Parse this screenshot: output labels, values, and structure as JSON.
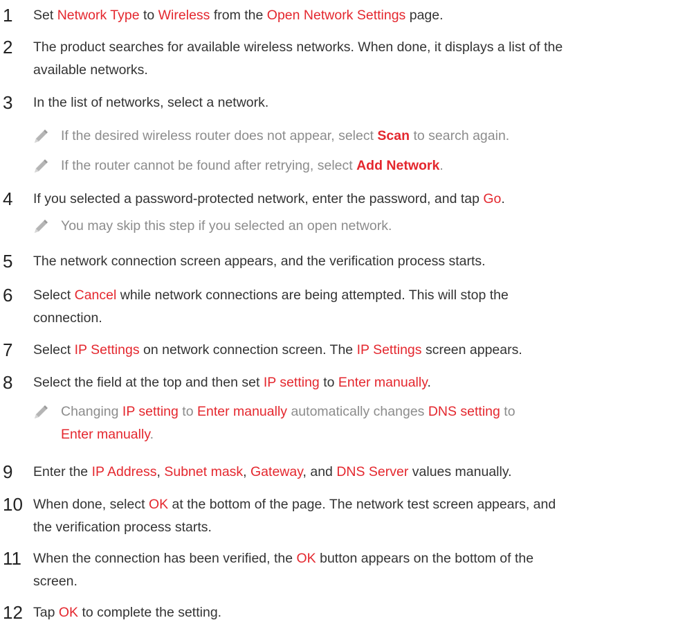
{
  "steps": [
    {
      "num": "1",
      "parts": [
        {
          "t": "Set "
        },
        {
          "t": "Network Type",
          "hl": true
        },
        {
          "t": " to "
        },
        {
          "t": "Wireless",
          "hl": true
        },
        {
          "t": " from the "
        },
        {
          "t": "Open Network Settings",
          "hl": true
        },
        {
          "t": " page."
        }
      ]
    },
    {
      "num": "2",
      "parts": [
        {
          "t": "The product searches for available wireless networks. When done, it displays a list of the"
        },
        {
          "br": true
        },
        {
          "t": "available networks."
        }
      ]
    },
    {
      "num": "3",
      "parts": [
        {
          "t": "In the list of networks, select a network."
        }
      ]
    },
    {
      "num": "4",
      "parts": [
        {
          "t": "If you selected a password-protected network, enter the password, and tap "
        },
        {
          "t": "Go",
          "hl": true
        },
        {
          "t": "."
        }
      ]
    },
    {
      "num": "5",
      "parts": [
        {
          "t": "The network connection screen appears, and the verification process starts."
        }
      ]
    },
    {
      "num": "6",
      "parts": [
        {
          "t": "Select "
        },
        {
          "t": "Cancel",
          "hl": true
        },
        {
          "t": " while network connections are being attempted. This will stop the"
        },
        {
          "br": true
        },
        {
          "t": "connection."
        }
      ]
    },
    {
      "num": "7",
      "parts": [
        {
          "t": "Select "
        },
        {
          "t": "IP Settings",
          "hl": true
        },
        {
          "t": " on network connection screen. The "
        },
        {
          "t": "IP Settings",
          "hl": true
        },
        {
          "t": " screen appears."
        }
      ]
    },
    {
      "num": "8",
      "parts": [
        {
          "t": "Select the field at the top and then set "
        },
        {
          "t": "IP setting",
          "hl": true
        },
        {
          "t": " to "
        },
        {
          "t": "Enter manually",
          "hl": true
        },
        {
          "t": "."
        }
      ]
    },
    {
      "num": "9",
      "parts": [
        {
          "t": "Enter the "
        },
        {
          "t": "IP Address",
          "hl": true
        },
        {
          "t": ", "
        },
        {
          "t": "Subnet mask",
          "hl": true
        },
        {
          "t": ", "
        },
        {
          "t": "Gateway",
          "hl": true
        },
        {
          "t": ", and "
        },
        {
          "t": "DNS Server",
          "hl": true
        },
        {
          "t": " values manually."
        }
      ]
    },
    {
      "num": "10",
      "parts": [
        {
          "t": "When done, select "
        },
        {
          "t": "OK",
          "hl": true
        },
        {
          "t": " at the bottom of the page. The network test screen appears, and"
        },
        {
          "br": true
        },
        {
          "t": "the verification process starts."
        }
      ]
    },
    {
      "num": "11",
      "parts": [
        {
          "t": "When the connection has been verified, the "
        },
        {
          "t": "OK",
          "hl": true
        },
        {
          "t": " button appears on the bottom of the"
        },
        {
          "br": true
        },
        {
          "t": "screen."
        }
      ]
    },
    {
      "num": "12",
      "parts": [
        {
          "t": "Tap "
        },
        {
          "t": "OK",
          "hl": true
        },
        {
          "t": " to complete the setting."
        }
      ]
    }
  ],
  "notes": [
    {
      "parts": [
        {
          "t": "If the desired wireless router does not appear, select "
        },
        {
          "t": "Scan",
          "hl": true,
          "bold": true
        },
        {
          "t": " to search again."
        }
      ]
    },
    {
      "parts": [
        {
          "t": "If the router cannot be found after retrying, select "
        },
        {
          "t": "Add Network",
          "hl": true,
          "bold": true
        },
        {
          "t": "."
        }
      ]
    },
    {
      "parts": [
        {
          "t": "You may skip this step if you selected an open network."
        }
      ]
    },
    {
      "parts": [
        {
          "t": "Changing "
        },
        {
          "t": "IP setting",
          "hl": true
        },
        {
          "t": " to "
        },
        {
          "t": "Enter manually",
          "hl": true
        },
        {
          "t": " automatically changes "
        },
        {
          "t": "DNS setting",
          "hl": true
        },
        {
          "t": " to"
        },
        {
          "br": true
        },
        {
          "t": "Enter manually",
          "hl": true
        },
        {
          "t": "."
        }
      ]
    }
  ],
  "icons": {
    "note": "pencil-icon"
  },
  "colors": {
    "highlight": "#e4272e",
    "note_text": "#8c8c8c",
    "body_text": "#333333"
  }
}
